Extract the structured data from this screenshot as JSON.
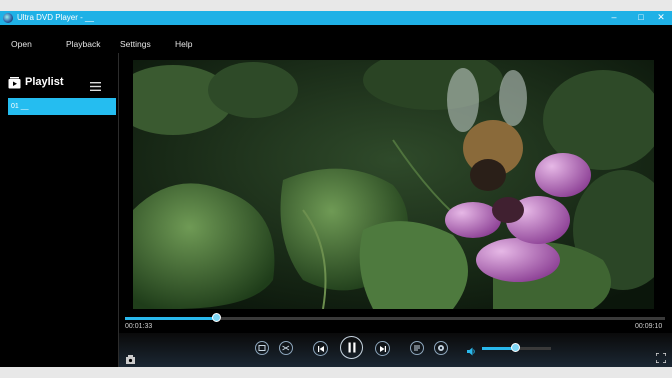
{
  "window": {
    "title": "Ultra DVD Player - __"
  },
  "menu": {
    "open": "Open",
    "playback": "Playback",
    "settings": "Settings",
    "help": "Help"
  },
  "playlist": {
    "title": "Playlist",
    "items": [
      {
        "label": "01 __"
      }
    ]
  },
  "player": {
    "current_time": "00:01:33",
    "total_time": "00:09:10",
    "progress_fraction": 0.17,
    "volume_fraction": 0.48
  },
  "colors": {
    "accent": "#29b8ec",
    "titlebar": "#1fb1e6",
    "background": "#000000"
  },
  "icons": [
    "app-icon",
    "minimize-icon",
    "maximize-icon",
    "close-icon",
    "playlist-icon",
    "menu-icon",
    "loop-icon",
    "shuffle-icon",
    "previous-icon",
    "pause-icon",
    "next-icon",
    "playlist-toggle-icon",
    "settings-icon",
    "volume-icon",
    "fullscreen-icon",
    "open-disc-icon"
  ]
}
